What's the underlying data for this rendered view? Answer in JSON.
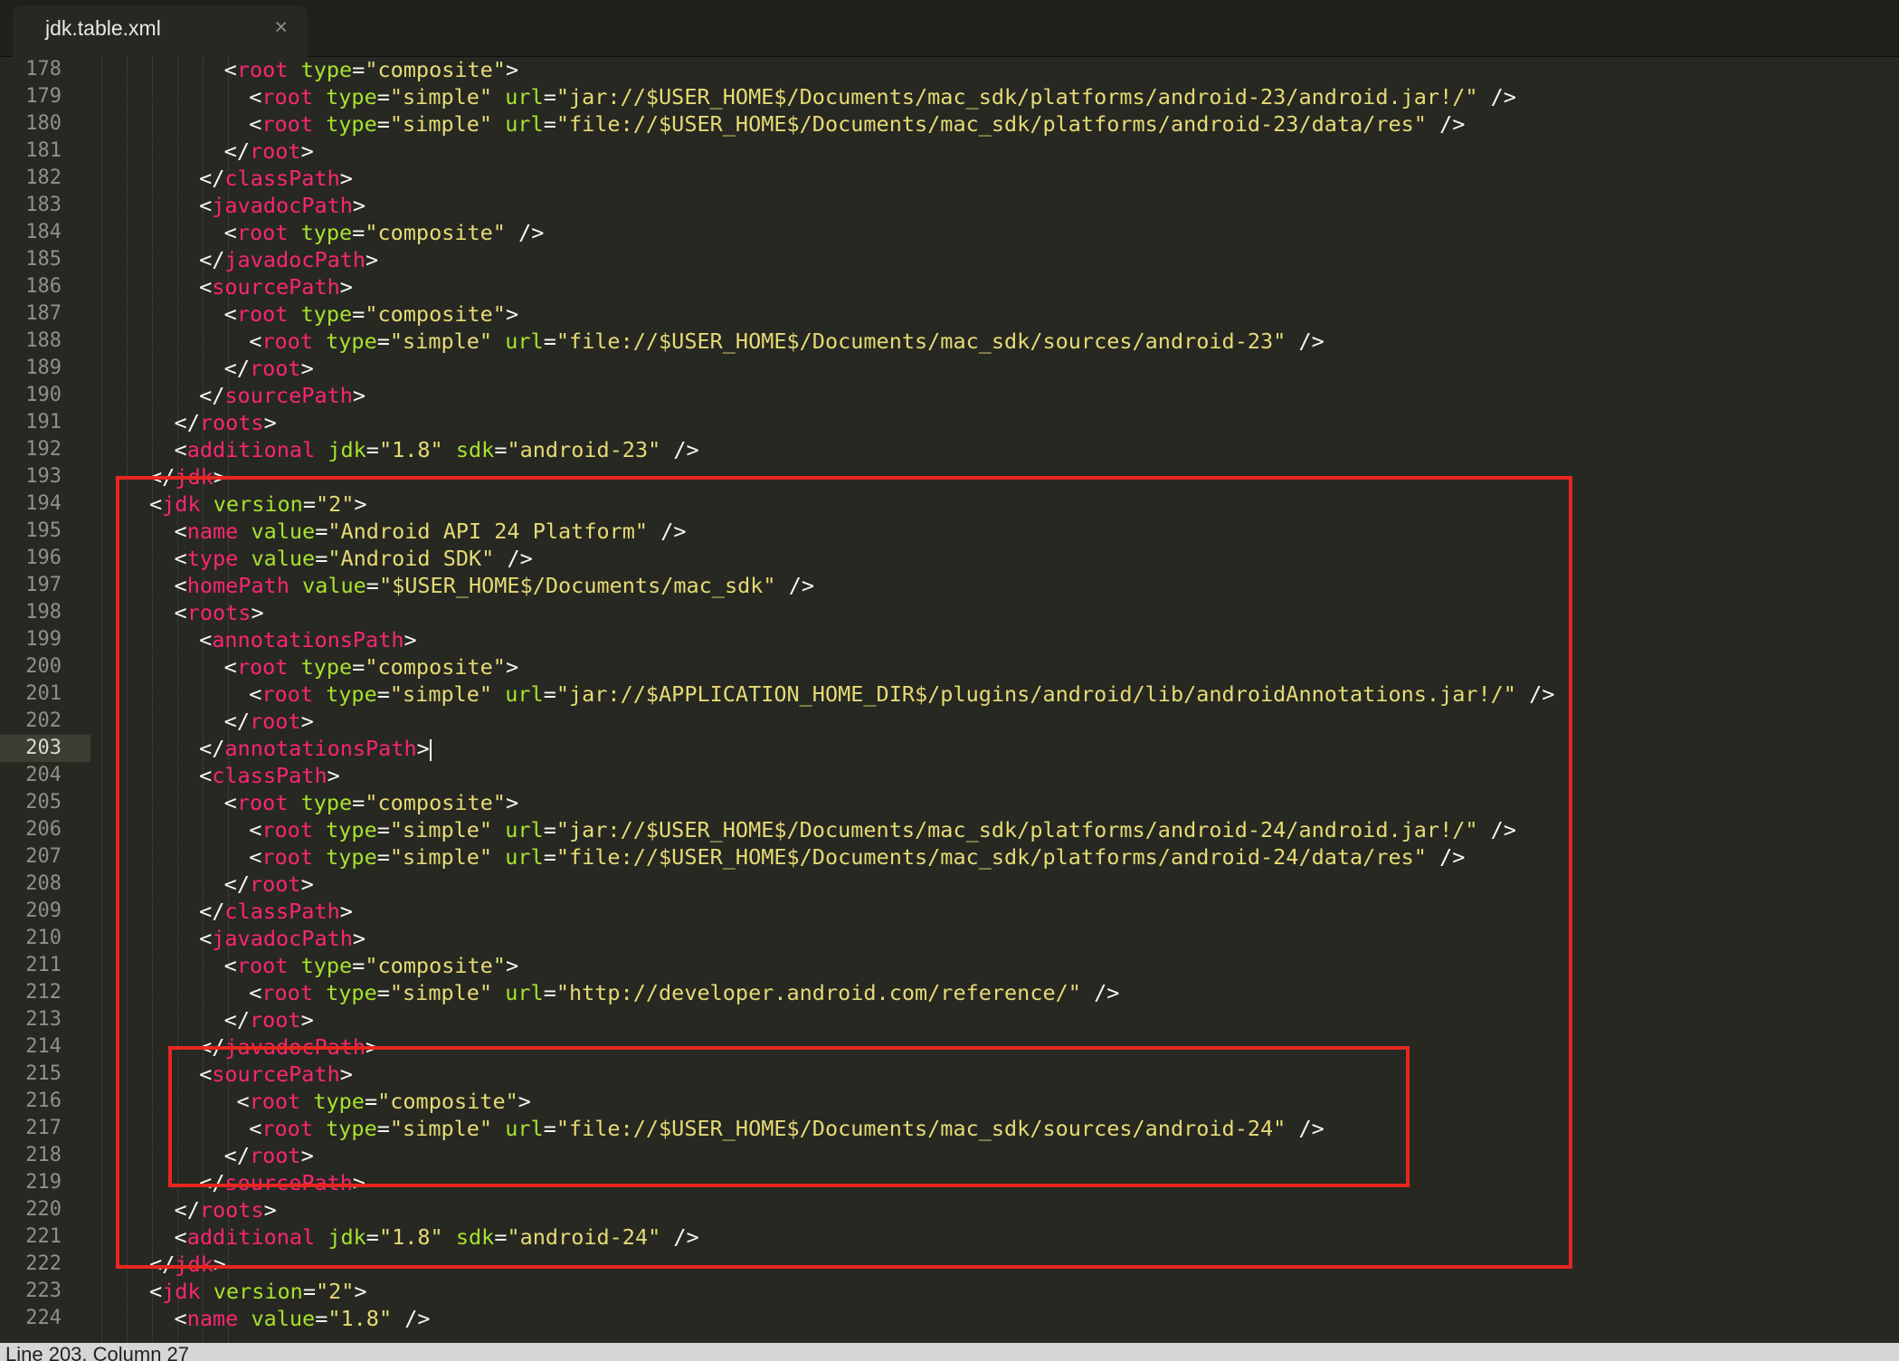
{
  "tab": {
    "title": "jdk.table.xml"
  },
  "status": "Line 203, Column 27",
  "active_line": 203,
  "colors": {
    "tag": "#f92672",
    "attr": "#a6e22e",
    "string": "#e6db74",
    "text": "#f8f8f2",
    "background": "#272822",
    "highlight_box": "#e8261f"
  },
  "lines": [
    {
      "n": 178,
      "indent": 3,
      "parts": [
        [
          "p",
          "<"
        ],
        [
          "t",
          "root"
        ],
        [
          "p",
          " "
        ],
        [
          "a",
          "type"
        ],
        [
          "p",
          "="
        ],
        [
          "s",
          "\"composite\""
        ],
        [
          "p",
          ">"
        ]
      ]
    },
    {
      "n": 179,
      "indent": 4,
      "parts": [
        [
          "p",
          "<"
        ],
        [
          "t",
          "root"
        ],
        [
          "p",
          " "
        ],
        [
          "a",
          "type"
        ],
        [
          "p",
          "="
        ],
        [
          "s",
          "\"simple\""
        ],
        [
          "p",
          " "
        ],
        [
          "a",
          "url"
        ],
        [
          "p",
          "="
        ],
        [
          "s",
          "\"jar://$USER_HOME$/Documents/mac_sdk/platforms/android-23/android.jar!/\""
        ],
        [
          "p",
          " />"
        ]
      ]
    },
    {
      "n": 180,
      "indent": 4,
      "parts": [
        [
          "p",
          "<"
        ],
        [
          "t",
          "root"
        ],
        [
          "p",
          " "
        ],
        [
          "a",
          "type"
        ],
        [
          "p",
          "="
        ],
        [
          "s",
          "\"simple\""
        ],
        [
          "p",
          " "
        ],
        [
          "a",
          "url"
        ],
        [
          "p",
          "="
        ],
        [
          "s",
          "\"file://$USER_HOME$/Documents/mac_sdk/platforms/android-23/data/res\""
        ],
        [
          "p",
          " />"
        ]
      ]
    },
    {
      "n": 181,
      "indent": 3,
      "parts": [
        [
          "p",
          "</"
        ],
        [
          "t",
          "root"
        ],
        [
          "p",
          ">"
        ]
      ]
    },
    {
      "n": 182,
      "indent": 2,
      "parts": [
        [
          "p",
          "</"
        ],
        [
          "t",
          "classPath"
        ],
        [
          "p",
          ">"
        ]
      ]
    },
    {
      "n": 183,
      "indent": 2,
      "parts": [
        [
          "p",
          "<"
        ],
        [
          "t",
          "javadocPath"
        ],
        [
          "p",
          ">"
        ]
      ]
    },
    {
      "n": 184,
      "indent": 3,
      "parts": [
        [
          "p",
          "<"
        ],
        [
          "t",
          "root"
        ],
        [
          "p",
          " "
        ],
        [
          "a",
          "type"
        ],
        [
          "p",
          "="
        ],
        [
          "s",
          "\"composite\""
        ],
        [
          "p",
          " />"
        ]
      ]
    },
    {
      "n": 185,
      "indent": 2,
      "parts": [
        [
          "p",
          "</"
        ],
        [
          "t",
          "javadocPath"
        ],
        [
          "p",
          ">"
        ]
      ]
    },
    {
      "n": 186,
      "indent": 2,
      "parts": [
        [
          "p",
          "<"
        ],
        [
          "t",
          "sourcePath"
        ],
        [
          "p",
          ">"
        ]
      ]
    },
    {
      "n": 187,
      "indent": 3,
      "parts": [
        [
          "p",
          "<"
        ],
        [
          "t",
          "root"
        ],
        [
          "p",
          " "
        ],
        [
          "a",
          "type"
        ],
        [
          "p",
          "="
        ],
        [
          "s",
          "\"composite\""
        ],
        [
          "p",
          ">"
        ]
      ]
    },
    {
      "n": 188,
      "indent": 4,
      "parts": [
        [
          "p",
          "<"
        ],
        [
          "t",
          "root"
        ],
        [
          "p",
          " "
        ],
        [
          "a",
          "type"
        ],
        [
          "p",
          "="
        ],
        [
          "s",
          "\"simple\""
        ],
        [
          "p",
          " "
        ],
        [
          "a",
          "url"
        ],
        [
          "p",
          "="
        ],
        [
          "s",
          "\"file://$USER_HOME$/Documents/mac_sdk/sources/android-23\""
        ],
        [
          "p",
          " />"
        ]
      ]
    },
    {
      "n": 189,
      "indent": 3,
      "parts": [
        [
          "p",
          "</"
        ],
        [
          "t",
          "root"
        ],
        [
          "p",
          ">"
        ]
      ]
    },
    {
      "n": 190,
      "indent": 2,
      "parts": [
        [
          "p",
          "</"
        ],
        [
          "t",
          "sourcePath"
        ],
        [
          "p",
          ">"
        ]
      ]
    },
    {
      "n": 191,
      "indent": 1,
      "parts": [
        [
          "p",
          "</"
        ],
        [
          "t",
          "roots"
        ],
        [
          "p",
          ">"
        ]
      ]
    },
    {
      "n": 192,
      "indent": 1,
      "parts": [
        [
          "p",
          "<"
        ],
        [
          "t",
          "additional"
        ],
        [
          "p",
          " "
        ],
        [
          "a",
          "jdk"
        ],
        [
          "p",
          "="
        ],
        [
          "s",
          "\"1.8\""
        ],
        [
          "p",
          " "
        ],
        [
          "a",
          "sdk"
        ],
        [
          "p",
          "="
        ],
        [
          "s",
          "\"android-23\""
        ],
        [
          "p",
          " />"
        ]
      ]
    },
    {
      "n": 193,
      "indent": 0,
      "parts": [
        [
          "p",
          "</"
        ],
        [
          "t",
          "jdk"
        ],
        [
          "p",
          ">"
        ]
      ]
    },
    {
      "n": 194,
      "indent": 0,
      "parts": [
        [
          "p",
          "<"
        ],
        [
          "t",
          "jdk"
        ],
        [
          "p",
          " "
        ],
        [
          "a",
          "version"
        ],
        [
          "p",
          "="
        ],
        [
          "s",
          "\"2\""
        ],
        [
          "p",
          ">"
        ]
      ]
    },
    {
      "n": 195,
      "indent": 1,
      "parts": [
        [
          "p",
          "<"
        ],
        [
          "t",
          "name"
        ],
        [
          "p",
          " "
        ],
        [
          "a",
          "value"
        ],
        [
          "p",
          "="
        ],
        [
          "s",
          "\"Android API 24 Platform\""
        ],
        [
          "p",
          " />"
        ]
      ]
    },
    {
      "n": 196,
      "indent": 1,
      "parts": [
        [
          "p",
          "<"
        ],
        [
          "t",
          "type"
        ],
        [
          "p",
          " "
        ],
        [
          "a",
          "value"
        ],
        [
          "p",
          "="
        ],
        [
          "s",
          "\"Android SDK\""
        ],
        [
          "p",
          " />"
        ]
      ]
    },
    {
      "n": 197,
      "indent": 1,
      "parts": [
        [
          "p",
          "<"
        ],
        [
          "t",
          "homePath"
        ],
        [
          "p",
          " "
        ],
        [
          "a",
          "value"
        ],
        [
          "p",
          "="
        ],
        [
          "s",
          "\"$USER_HOME$/Documents/mac_sdk\""
        ],
        [
          "p",
          " />"
        ]
      ]
    },
    {
      "n": 198,
      "indent": 1,
      "parts": [
        [
          "p",
          "<"
        ],
        [
          "t",
          "roots"
        ],
        [
          "p",
          ">"
        ]
      ]
    },
    {
      "n": 199,
      "indent": 2,
      "parts": [
        [
          "p",
          "<"
        ],
        [
          "t",
          "annotationsPath"
        ],
        [
          "p",
          ">"
        ]
      ]
    },
    {
      "n": 200,
      "indent": 3,
      "parts": [
        [
          "p",
          "<"
        ],
        [
          "t",
          "root"
        ],
        [
          "p",
          " "
        ],
        [
          "a",
          "type"
        ],
        [
          "p",
          "="
        ],
        [
          "s",
          "\"composite\""
        ],
        [
          "p",
          ">"
        ]
      ]
    },
    {
      "n": 201,
      "indent": 4,
      "parts": [
        [
          "p",
          "<"
        ],
        [
          "t",
          "root"
        ],
        [
          "p",
          " "
        ],
        [
          "a",
          "type"
        ],
        [
          "p",
          "="
        ],
        [
          "s",
          "\"simple\""
        ],
        [
          "p",
          " "
        ],
        [
          "a",
          "url"
        ],
        [
          "p",
          "="
        ],
        [
          "s",
          "\"jar://$APPLICATION_HOME_DIR$/plugins/android/lib/androidAnnotations.jar!/\""
        ],
        [
          "p",
          " />"
        ]
      ]
    },
    {
      "n": 202,
      "indent": 3,
      "parts": [
        [
          "p",
          "</"
        ],
        [
          "t",
          "root"
        ],
        [
          "p",
          ">"
        ]
      ]
    },
    {
      "n": 203,
      "indent": 2,
      "cursor": true,
      "parts": [
        [
          "p",
          "</"
        ],
        [
          "t",
          "annotationsPath"
        ],
        [
          "p",
          ">"
        ]
      ]
    },
    {
      "n": 204,
      "indent": 2,
      "parts": [
        [
          "p",
          "<"
        ],
        [
          "t",
          "classPath"
        ],
        [
          "p",
          ">"
        ]
      ]
    },
    {
      "n": 205,
      "indent": 3,
      "parts": [
        [
          "p",
          "<"
        ],
        [
          "t",
          "root"
        ],
        [
          "p",
          " "
        ],
        [
          "a",
          "type"
        ],
        [
          "p",
          "="
        ],
        [
          "s",
          "\"composite\""
        ],
        [
          "p",
          ">"
        ]
      ]
    },
    {
      "n": 206,
      "indent": 4,
      "parts": [
        [
          "p",
          "<"
        ],
        [
          "t",
          "root"
        ],
        [
          "p",
          " "
        ],
        [
          "a",
          "type"
        ],
        [
          "p",
          "="
        ],
        [
          "s",
          "\"simple\""
        ],
        [
          "p",
          " "
        ],
        [
          "a",
          "url"
        ],
        [
          "p",
          "="
        ],
        [
          "s",
          "\"jar://$USER_HOME$/Documents/mac_sdk/platforms/android-24/android.jar!/\""
        ],
        [
          "p",
          " />"
        ]
      ]
    },
    {
      "n": 207,
      "indent": 4,
      "parts": [
        [
          "p",
          "<"
        ],
        [
          "t",
          "root"
        ],
        [
          "p",
          " "
        ],
        [
          "a",
          "type"
        ],
        [
          "p",
          "="
        ],
        [
          "s",
          "\"simple\""
        ],
        [
          "p",
          " "
        ],
        [
          "a",
          "url"
        ],
        [
          "p",
          "="
        ],
        [
          "s",
          "\"file://$USER_HOME$/Documents/mac_sdk/platforms/android-24/data/res\""
        ],
        [
          "p",
          " />"
        ]
      ]
    },
    {
      "n": 208,
      "indent": 3,
      "parts": [
        [
          "p",
          "</"
        ],
        [
          "t",
          "root"
        ],
        [
          "p",
          ">"
        ]
      ]
    },
    {
      "n": 209,
      "indent": 2,
      "parts": [
        [
          "p",
          "</"
        ],
        [
          "t",
          "classPath"
        ],
        [
          "p",
          ">"
        ]
      ]
    },
    {
      "n": 210,
      "indent": 2,
      "parts": [
        [
          "p",
          "<"
        ],
        [
          "t",
          "javadocPath"
        ],
        [
          "p",
          ">"
        ]
      ]
    },
    {
      "n": 211,
      "indent": 3,
      "parts": [
        [
          "p",
          "<"
        ],
        [
          "t",
          "root"
        ],
        [
          "p",
          " "
        ],
        [
          "a",
          "type"
        ],
        [
          "p",
          "="
        ],
        [
          "s",
          "\"composite\""
        ],
        [
          "p",
          ">"
        ]
      ]
    },
    {
      "n": 212,
      "indent": 4,
      "parts": [
        [
          "p",
          "<"
        ],
        [
          "t",
          "root"
        ],
        [
          "p",
          " "
        ],
        [
          "a",
          "type"
        ],
        [
          "p",
          "="
        ],
        [
          "s",
          "\"simple\""
        ],
        [
          "p",
          " "
        ],
        [
          "a",
          "url"
        ],
        [
          "p",
          "="
        ],
        [
          "s",
          "\"http://developer.android.com/reference/\""
        ],
        [
          "p",
          " />"
        ]
      ]
    },
    {
      "n": 213,
      "indent": 3,
      "parts": [
        [
          "p",
          "</"
        ],
        [
          "t",
          "root"
        ],
        [
          "p",
          ">"
        ]
      ]
    },
    {
      "n": 214,
      "indent": 2,
      "parts": [
        [
          "p",
          "</"
        ],
        [
          "t",
          "javadocPath"
        ],
        [
          "p",
          ">"
        ]
      ]
    },
    {
      "n": 215,
      "indent": 2,
      "parts": [
        [
          "p",
          "<"
        ],
        [
          "t",
          "sourcePath"
        ],
        [
          "p",
          ">"
        ]
      ]
    },
    {
      "n": 216,
      "indent": 3.5,
      "parts": [
        [
          "p",
          "<"
        ],
        [
          "t",
          "root"
        ],
        [
          "p",
          " "
        ],
        [
          "a",
          "type"
        ],
        [
          "p",
          "="
        ],
        [
          "s",
          "\"composite\""
        ],
        [
          "p",
          ">"
        ]
      ]
    },
    {
      "n": 217,
      "indent": 4,
      "parts": [
        [
          "p",
          "<"
        ],
        [
          "t",
          "root"
        ],
        [
          "p",
          " "
        ],
        [
          "a",
          "type"
        ],
        [
          "p",
          "="
        ],
        [
          "s",
          "\"simple\""
        ],
        [
          "p",
          " "
        ],
        [
          "a",
          "url"
        ],
        [
          "p",
          "="
        ],
        [
          "s",
          "\"file://$USER_HOME$/Documents/mac_sdk/sources/android-24\""
        ],
        [
          "p",
          " />"
        ]
      ]
    },
    {
      "n": 218,
      "indent": 3,
      "parts": [
        [
          "p",
          "</"
        ],
        [
          "t",
          "root"
        ],
        [
          "p",
          ">"
        ]
      ]
    },
    {
      "n": 219,
      "indent": 2,
      "parts": [
        [
          "p",
          "</"
        ],
        [
          "t",
          "sourcePath"
        ],
        [
          "p",
          ">"
        ]
      ]
    },
    {
      "n": 220,
      "indent": 1,
      "parts": [
        [
          "p",
          "</"
        ],
        [
          "t",
          "roots"
        ],
        [
          "p",
          ">"
        ]
      ]
    },
    {
      "n": 221,
      "indent": 1,
      "parts": [
        [
          "p",
          "<"
        ],
        [
          "t",
          "additional"
        ],
        [
          "p",
          " "
        ],
        [
          "a",
          "jdk"
        ],
        [
          "p",
          "="
        ],
        [
          "s",
          "\"1.8\""
        ],
        [
          "p",
          " "
        ],
        [
          "a",
          "sdk"
        ],
        [
          "p",
          "="
        ],
        [
          "s",
          "\"android-24\""
        ],
        [
          "p",
          " />"
        ]
      ]
    },
    {
      "n": 222,
      "indent": 0,
      "parts": [
        [
          "p",
          "</"
        ],
        [
          "t",
          "jdk"
        ],
        [
          "p",
          ">"
        ]
      ]
    },
    {
      "n": 223,
      "indent": 0,
      "parts": [
        [
          "p",
          "<"
        ],
        [
          "t",
          "jdk"
        ],
        [
          "p",
          " "
        ],
        [
          "a",
          "version"
        ],
        [
          "p",
          "="
        ],
        [
          "s",
          "\"2\""
        ],
        [
          "p",
          ">"
        ]
      ]
    },
    {
      "n": 224,
      "indent": 1,
      "parts": [
        [
          "p",
          "<"
        ],
        [
          "t",
          "name"
        ],
        [
          "p",
          " "
        ],
        [
          "a",
          "value"
        ],
        [
          "p",
          "="
        ],
        [
          "s",
          "\"1.8\""
        ],
        [
          "p",
          " />"
        ]
      ]
    }
  ],
  "highlights": [
    {
      "name": "jdk-block-highlight",
      "from_line": 194,
      "to_line": 222
    },
    {
      "name": "sourcepath-highlight",
      "from_line": 215,
      "to_line": 219
    }
  ]
}
